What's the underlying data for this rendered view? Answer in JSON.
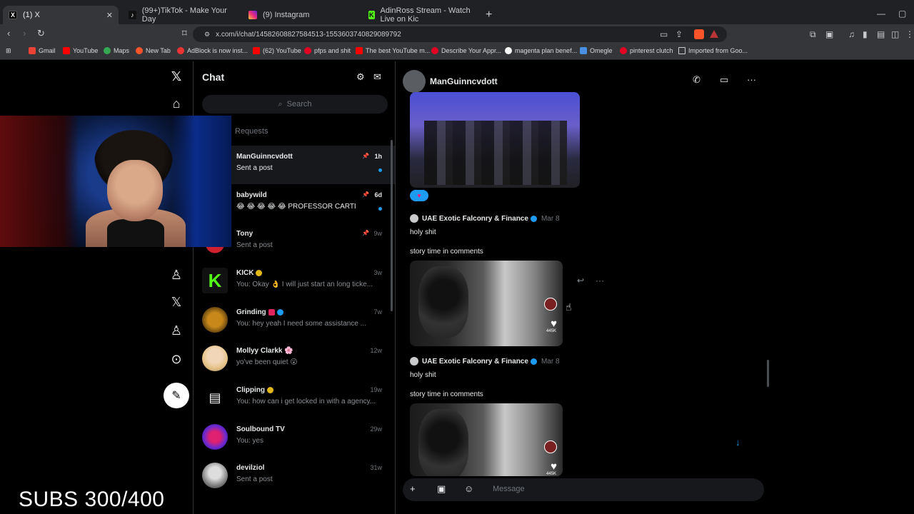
{
  "browser": {
    "tabs": [
      {
        "title": "(1) X",
        "active": true,
        "favicon": "x-logo"
      },
      {
        "title": "(99+)TikTok - Make Your Day",
        "favicon": "tiktok-logo"
      },
      {
        "title": "(9) Instagram",
        "favicon": "instagram-logo"
      },
      {
        "title": "AdinRoss Stream - Watch Live on Kic",
        "favicon": "kick-logo"
      }
    ],
    "url": "x.com/i/chat/1458260882758451​3-1553603740829089792",
    "bookmarks": [
      "Gmail",
      "YouTube",
      "Maps",
      "New Tab",
      "AdBlock is now inst...",
      "(62) YouTube",
      "pfps and shit",
      "The best YouTube m...",
      "Describe Your Appr...",
      "magenta plan benef...",
      "Omegle",
      "pinterest clutch",
      "Imported from Goo..."
    ]
  },
  "chatlist": {
    "title": "Chat",
    "search_placeholder": "Search",
    "requests_label": "Requests",
    "conversations": [
      {
        "name": "ManGuinncvdott",
        "preview": "Sent a post",
        "time": "1h",
        "pinned": true,
        "unread": true
      },
      {
        "name": "babywild",
        "preview": "😂 😂 😂 😂 😂 PROFESSOR CARTI",
        "time": "6d",
        "pinned": true,
        "unread": true
      },
      {
        "name": "Tony",
        "preview": "Sent a post",
        "time": "9w",
        "pinned": true,
        "unread": false
      },
      {
        "name": "KICK",
        "preview": "You: Okay 👌 I will just start an long ticke...",
        "time": "3w",
        "pinned": false,
        "unread": false
      },
      {
        "name": "Grinding",
        "preview": "You: hey yeah I need some assistance ...",
        "time": "7w",
        "pinned": false,
        "unread": false
      },
      {
        "name": "Mollyy Clarkk 🌸",
        "preview": "yo've been quiet 😮",
        "time": "12w",
        "pinned": false,
        "unread": false
      },
      {
        "name": "Clipping",
        "preview": "You: how can i get locked in with a agency...",
        "time": "19w",
        "pinned": false,
        "unread": false
      },
      {
        "name": "Soulbound TV",
        "preview": "You: yes",
        "time": "29w",
        "pinned": false,
        "unread": false
      },
      {
        "name": "devilziol",
        "preview": "Sent a post",
        "time": "31w",
        "pinned": false,
        "unread": false
      }
    ]
  },
  "pane": {
    "contact_name": "ManGuinncvdott",
    "posts": [
      {
        "author": "UAE Exotic Falconry & Finance",
        "date": "Mar 8",
        "text": "holy shit",
        "caption": "story time in comments",
        "likes": "445K"
      },
      {
        "author": "UAE Exotic Falconry & Finance",
        "date": "Mar 8",
        "text": "holy shit",
        "caption": "story time in comments",
        "likes": "445K"
      }
    ],
    "composer_placeholder": "Message"
  },
  "overlay": {
    "subs_text": "SUBS 300/400"
  },
  "colors": {
    "accent": "#1d9bf0",
    "background": "#000000",
    "kick_green": "#53fc18"
  }
}
